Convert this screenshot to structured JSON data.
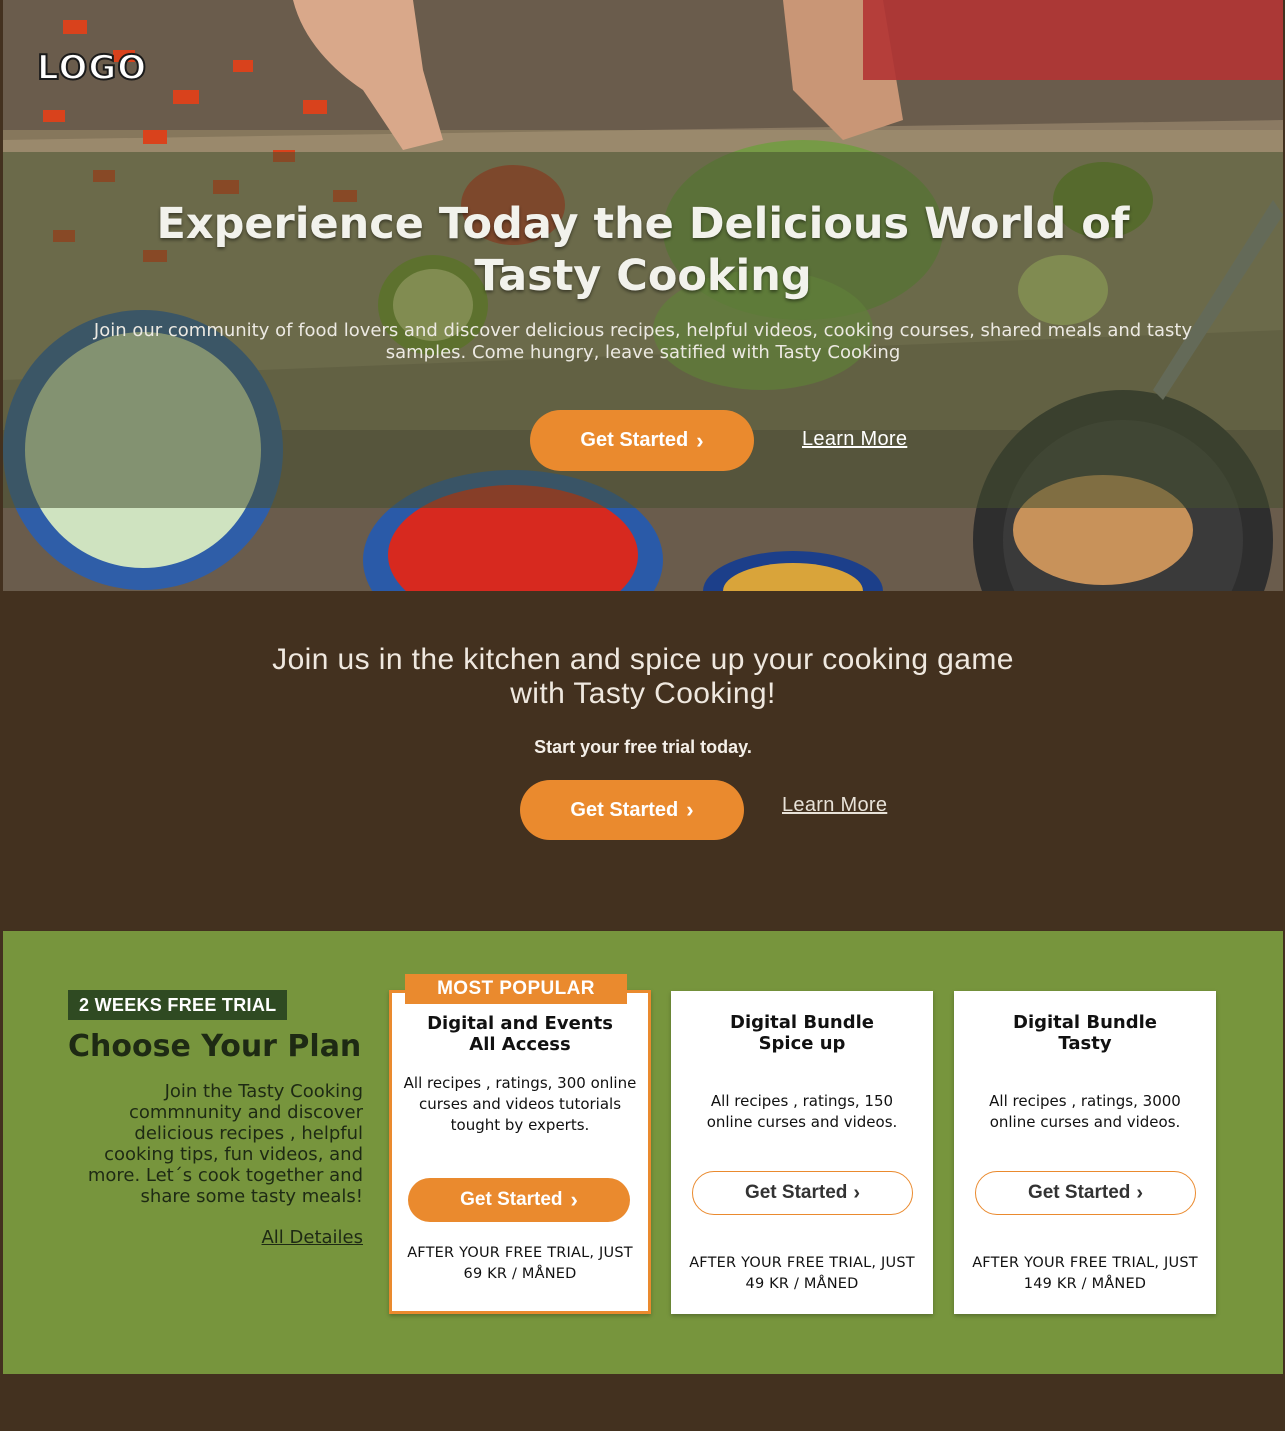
{
  "hero": {
    "logo": "LOGO",
    "title": "Experience  Today the Delicious  World of Tasty Cooking",
    "subtitle": "Join our community of food lovers and discover delicious recipes, helpful videos, cooking courses, shared meals and tasty samples. Come hungry, leave satified with Tasty Cooking",
    "cta_label": "Get Started",
    "learn_label": "Learn More"
  },
  "promo": {
    "heading": "Join us in the kitchen and spice up your cooking game with Tasty Cooking!",
    "sub": "Start your free trial today.",
    "cta_label": "Get Started",
    "learn_label": "Learn More"
  },
  "plans": {
    "badge": "2 WEEKS FREE TRIAL",
    "title": "Choose Your Plan",
    "description": "Join the Tasty Cooking commnunity and discover delicious recipes , helpful cooking tips, fun videos, and more. Let´s cook together and share some tasty meals!",
    "details_link": "All Detailes",
    "cards": [
      {
        "flag": "MOST POPULAR",
        "title": "Digital  and Events All Access",
        "description": "All recipes , ratings, 300 online curses and videos tutorials tought by experts.",
        "button": "Get Started",
        "price": "AFTER YOUR FREE TRIAL, JUST 69 KR / MÅNED"
      },
      {
        "title": "Digital Bundle Spice up",
        "description": "All recipes , ratings, 150 online curses  and videos.",
        "button": "Get Started",
        "price": "AFTER YOUR FREE TRIAL, JUST 49 KR / MÅNED"
      },
      {
        "title": "Digital Bundle Tasty",
        "description": "All recipes , ratings, 3000 online curses  and videos.",
        "button": "Get Started",
        "price": "AFTER YOUR FREE TRIAL, JUST 149 KR / MÅNED"
      }
    ]
  },
  "colors": {
    "accent": "#ea8a2e",
    "dark_brown": "#43311f",
    "green": "#77953d",
    "badge_green": "#2f4a22"
  },
  "icons": {
    "chevron": "chevron-right-icon"
  }
}
